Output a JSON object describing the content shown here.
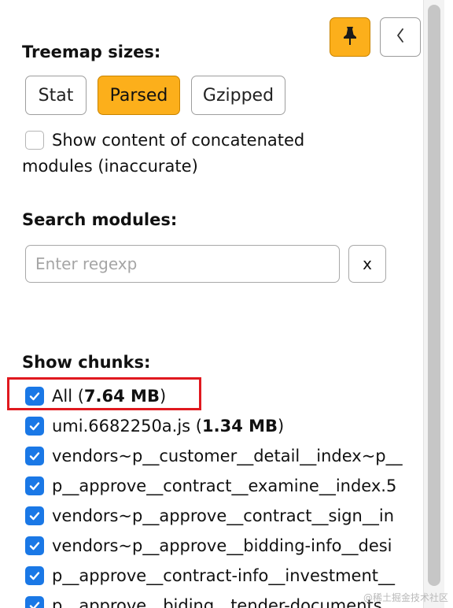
{
  "toolbar": {
    "pin_icon": "pin-icon",
    "back_icon": "chevron-left-icon"
  },
  "treemap": {
    "heading": "Treemap sizes:",
    "options": [
      "Stat",
      "Parsed",
      "Gzipped"
    ],
    "active": "Parsed"
  },
  "concat": {
    "checked": false,
    "label": "Show content of concatenated modules (inaccurate)"
  },
  "search": {
    "heading": "Search modules:",
    "placeholder": "Enter regexp",
    "clear_label": "x"
  },
  "chunks": {
    "heading": "Show chunks:",
    "items": [
      {
        "name": "All",
        "size": "7.64 MB",
        "checked": true
      },
      {
        "name": "umi.6682250a.js",
        "size": "1.34 MB",
        "checked": true
      },
      {
        "name": "vendors~p__customer__detail__index~p__",
        "checked": true
      },
      {
        "name": "p__approve__contract__examine__index.5",
        "checked": true
      },
      {
        "name": "vendors~p__approve__contract__sign__in",
        "checked": true
      },
      {
        "name": "vendors~p__approve__bidding-info__desi",
        "checked": true
      },
      {
        "name": "p__approve__contract-info__investment__",
        "checked": true
      },
      {
        "name": "p__approve__biding__tender-documents",
        "checked": true
      }
    ]
  },
  "watermark": "@稀土掘金技术社区",
  "colors": {
    "accent": "#fcaf1b",
    "checkbox": "#1a78e6",
    "highlight": "#e0191f"
  }
}
